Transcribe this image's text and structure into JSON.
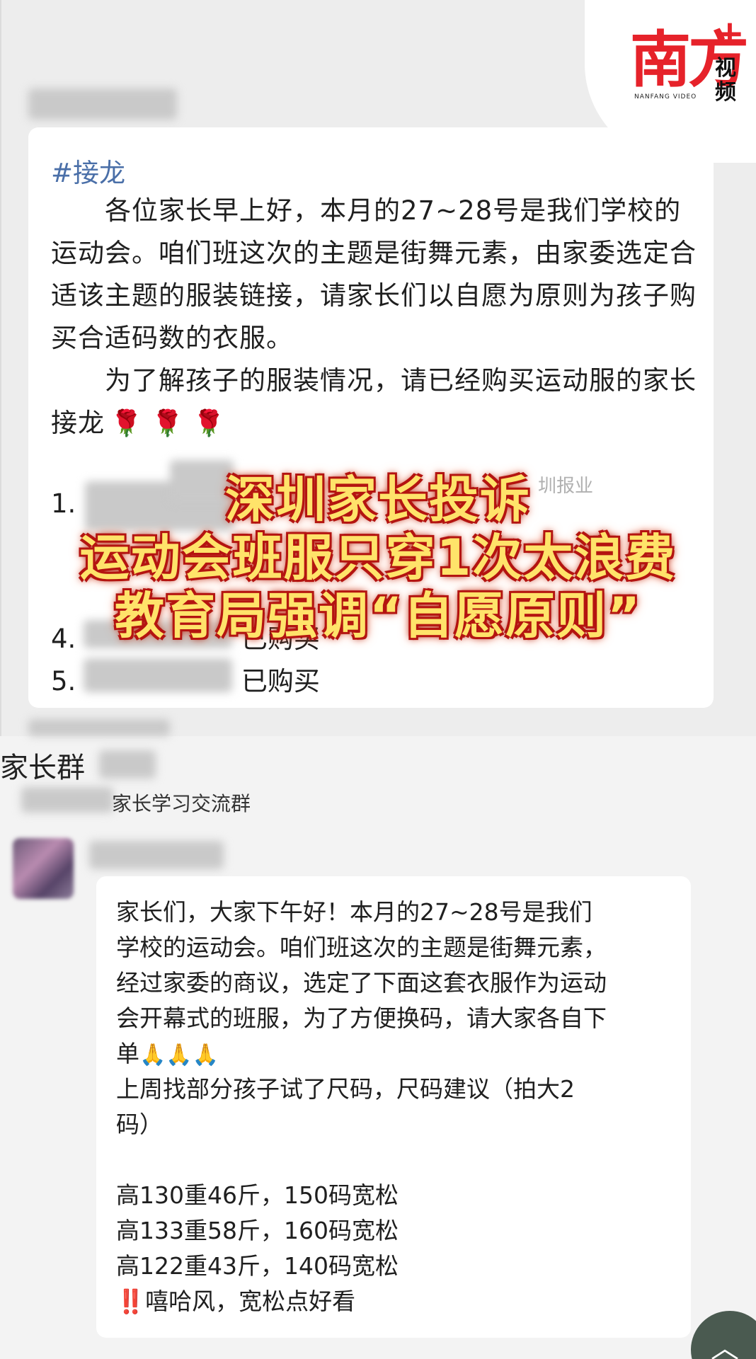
{
  "logo": {
    "main": "南方",
    "plus": "+",
    "side": "视频",
    "english": "NANFANG VIDEO"
  },
  "message1": {
    "tag": "#接龙",
    "para1": "　　各位家长早上好，本月的27~28号是我们学校的运动会。咱们班这次的主题是街舞元素，由家委选定合适该主题的服装链接，请家长们以自愿为原则为孩子购买合适码数的衣服。",
    "para2": "　　为了解孩子的服装情况，请已经购买运动服的家长接龙",
    "roses": "🌹 🌹 🌹",
    "list": [
      {
        "num": "1.",
        "text": ""
      },
      {
        "num": "4.",
        "text": "已购买"
      },
      {
        "num": "5.",
        "text": "已购买"
      }
    ]
  },
  "headline": {
    "line1": "深圳家长投诉",
    "line2": "运动会班服只穿1次太浪费",
    "line3": "教育局强调“自愿原则”"
  },
  "watermark": "圳报业",
  "group": {
    "name": "家长群",
    "subtitle": "家长学习交流群"
  },
  "message2": {
    "lines": [
      "家长们，大家下午好！本月的27~28号是我们",
      "学校的运动会。咱们班这次的主题是街舞元素，",
      "经过家委的商议，选定了下面这套衣服作为运动",
      "会开幕式的班服，为了方便换码，请大家各自下",
      "单",
      "上周找部分孩子试了尺码，尺码建议（拍大2",
      "码）",
      "",
      "高130重46斤，150码宽松",
      "高133重58斤，160码宽松",
      "高122重43斤，140码宽松",
      "‼️嘻哈风，宽松点好看"
    ],
    "pray": "🙏🙏🙏"
  },
  "colors": {
    "headline_fill": "#ffe36a",
    "headline_stroke": "#b41410",
    "logo_red": "#e6222a",
    "tag_blue": "#4a6fa8"
  },
  "icons": {
    "scroll_top": "chevron-up-icon"
  }
}
